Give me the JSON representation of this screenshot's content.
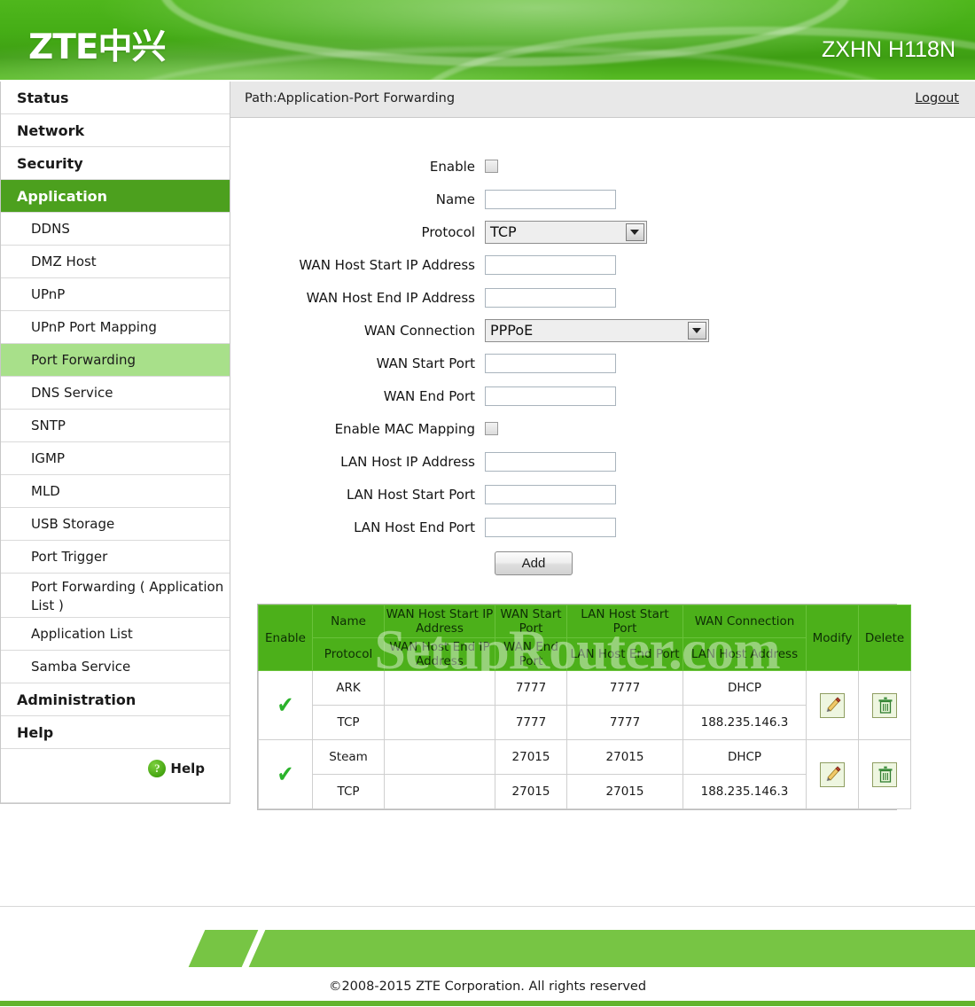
{
  "header": {
    "logo": "ZTE中兴",
    "model": "ZXHN H118N"
  },
  "sidebar": {
    "items": [
      {
        "label": "Status",
        "level": "top",
        "state": "normal"
      },
      {
        "label": "Network",
        "level": "top",
        "state": "normal"
      },
      {
        "label": "Security",
        "level": "top",
        "state": "normal"
      },
      {
        "label": "Application",
        "level": "top",
        "state": "active"
      },
      {
        "label": "DDNS",
        "level": "sub",
        "state": "normal"
      },
      {
        "label": "DMZ Host",
        "level": "sub",
        "state": "normal"
      },
      {
        "label": "UPnP",
        "level": "sub",
        "state": "normal"
      },
      {
        "label": "UPnP Port Mapping",
        "level": "sub",
        "state": "normal"
      },
      {
        "label": "Port Forwarding",
        "level": "sub",
        "state": "active"
      },
      {
        "label": "DNS Service",
        "level": "sub",
        "state": "normal"
      },
      {
        "label": "SNTP",
        "level": "sub",
        "state": "normal"
      },
      {
        "label": "IGMP",
        "level": "sub",
        "state": "normal"
      },
      {
        "label": "MLD",
        "level": "sub",
        "state": "normal"
      },
      {
        "label": "USB Storage",
        "level": "sub",
        "state": "normal"
      },
      {
        "label": "Port Trigger",
        "level": "sub",
        "state": "normal"
      },
      {
        "label": "Port Forwarding ( Application List )",
        "level": "sub-two",
        "state": "normal"
      },
      {
        "label": "Application List",
        "level": "sub",
        "state": "normal"
      },
      {
        "label": "Samba Service",
        "level": "sub",
        "state": "normal"
      },
      {
        "label": "Administration",
        "level": "top",
        "state": "normal"
      },
      {
        "label": "Help",
        "level": "top",
        "state": "normal"
      }
    ],
    "help": {
      "icon": "question-mark-icon",
      "glyph": "?",
      "label": "Help"
    }
  },
  "pathbar": {
    "path": "Path:Application-Port Forwarding",
    "logout": "Logout"
  },
  "form": {
    "enable_label": "Enable",
    "enable_checked": false,
    "name_label": "Name",
    "name_value": "",
    "protocol_label": "Protocol",
    "protocol_value": "TCP",
    "wan_host_start_ip_label": "WAN Host Start IP Address",
    "wan_host_start_ip_value": "",
    "wan_host_end_ip_label": "WAN Host End IP Address",
    "wan_host_end_ip_value": "",
    "wan_connection_label": "WAN Connection",
    "wan_connection_value": "PPPoE",
    "wan_start_port_label": "WAN Start Port",
    "wan_start_port_value": "",
    "wan_end_port_label": "WAN End Port",
    "wan_end_port_value": "",
    "enable_mac_mapping_label": "Enable MAC Mapping",
    "enable_mac_mapping_checked": false,
    "lan_host_ip_label": "LAN Host IP Address",
    "lan_host_ip_value": "",
    "lan_host_start_port_label": "LAN Host Start Port",
    "lan_host_start_port_value": "",
    "lan_host_end_port_label": "LAN Host End Port",
    "lan_host_end_port_value": "",
    "add_button": "Add"
  },
  "table": {
    "headers_row1": [
      "Enable",
      "Name",
      "WAN Host Start IP Address",
      "WAN Start Port",
      "LAN Host Start Port",
      "WAN Connection",
      "Modify",
      "Delete"
    ],
    "headers_row2": [
      "Protocol",
      "WAN Host End IP Address",
      "WAN End Port",
      "LAN Host End Port",
      "LAN Host Address"
    ],
    "watermark": "SetupRouter.com",
    "rows": [
      {
        "enable": "✔",
        "name": "ARK",
        "protocol": "TCP",
        "wan_host_start_ip": "",
        "wan_host_end_ip": "",
        "wan_start_port": "7777",
        "wan_end_port": "7777",
        "lan_host_start_port": "7777",
        "lan_host_end_port": "7777",
        "wan_connection": "DHCP",
        "lan_host_address": "188.235.146.3",
        "modify_icon": "pencil-icon",
        "delete_icon": "trash-icon"
      },
      {
        "enable": "✔",
        "name": "Steam",
        "protocol": "TCP",
        "wan_host_start_ip": "",
        "wan_host_end_ip": "",
        "wan_start_port": "27015",
        "wan_end_port": "27015",
        "lan_host_start_port": "27015",
        "lan_host_end_port": "27015",
        "wan_connection": "DHCP",
        "lan_host_address": "188.235.146.3",
        "modify_icon": "pencil-icon",
        "delete_icon": "trash-icon"
      }
    ]
  },
  "footer": {
    "copyright": "©2008-2015 ZTE Corporation. All rights reserved"
  },
  "colors": {
    "brand_green": "#4cb01a",
    "header_green": "#45ad16",
    "active_sub": "#a8e08a",
    "footer_bar": "#77c544"
  }
}
